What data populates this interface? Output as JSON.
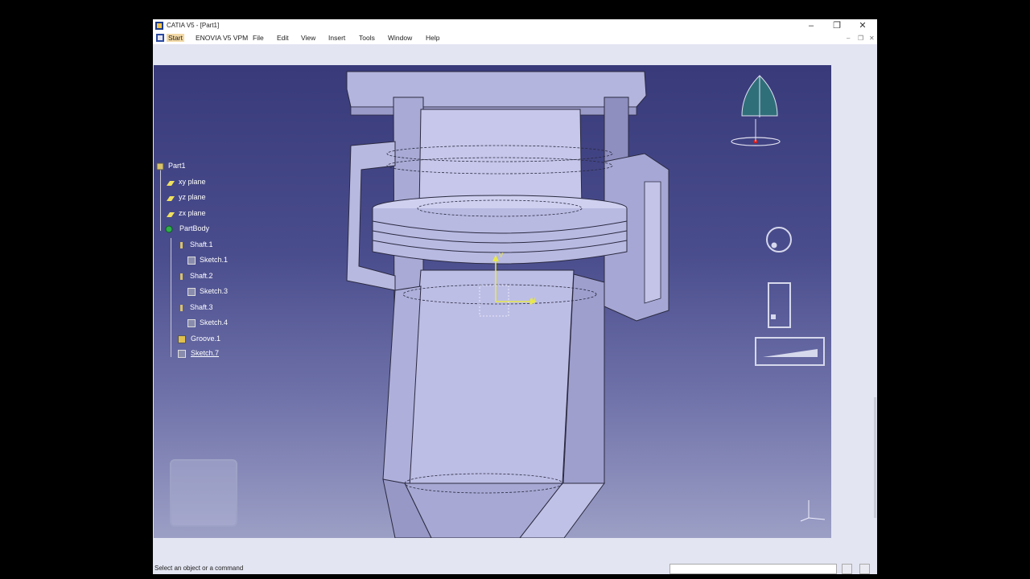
{
  "window": {
    "title": "CATIA V5 - [Part1]",
    "controls": {
      "minimize": "–",
      "restore": "❐",
      "close": "✕"
    },
    "mdi_controls": {
      "minimize": "–",
      "restore": "❐",
      "close": "✕"
    }
  },
  "menu": {
    "items": [
      "Start",
      "ENOVIA V5 VPM",
      "File",
      "Edit",
      "View",
      "Insert",
      "Tools",
      "Window",
      "Help"
    ]
  },
  "tree": {
    "root": "Part1",
    "planes": [
      "xy plane",
      "yz plane",
      "zx plane"
    ],
    "body": "PartBody",
    "features": [
      {
        "name": "Shaft.1",
        "child": "Sketch.1"
      },
      {
        "name": "Shaft.2",
        "child": "Sketch.3"
      },
      {
        "name": "Shaft.3",
        "child": "Sketch.4"
      }
    ],
    "groove": "Groove.1",
    "active_sketch": "Sketch.7"
  },
  "axis_labels": {
    "h": "H",
    "v": "V"
  },
  "status": {
    "message": "Select an object or a command",
    "command_input": ""
  },
  "colors": {
    "viewport_top": "#383a7a",
    "viewport_bottom": "#9c9fc5",
    "part_face": "#b8b9e0",
    "tree_text": "#ffffff",
    "sketch_axis": "#e8e84a",
    "compass": "#2f6f7a",
    "menu_start_highlight": "#f3d9a6"
  }
}
